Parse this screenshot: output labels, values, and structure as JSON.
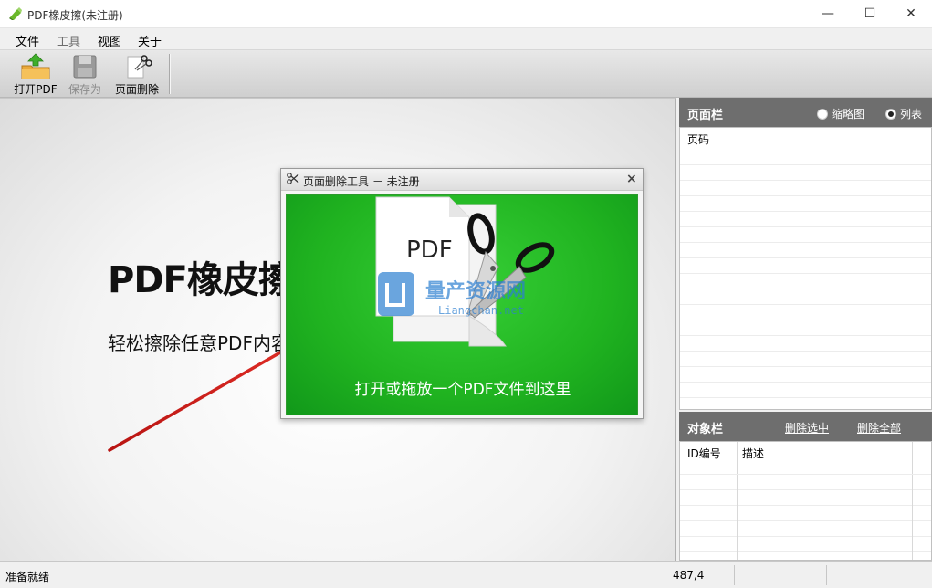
{
  "window": {
    "title": "PDF橡皮擦(未注册)",
    "minimize": "—",
    "maximize": "☐",
    "close": "✕"
  },
  "menu": [
    {
      "label": "文件",
      "enabled": true
    },
    {
      "label": "工具",
      "enabled": false
    },
    {
      "label": "视图",
      "enabled": true
    },
    {
      "label": "关于",
      "enabled": true
    }
  ],
  "toolbar": {
    "open_pdf": "打开PDF",
    "save_as": "保存为",
    "page_delete": "页面删除"
  },
  "main": {
    "brand_title": "PDF橡皮擦",
    "brand_subtitle": "轻松擦除任意PDF内容"
  },
  "dialog": {
    "title": "页面删除工具 － 未注册",
    "close": "×",
    "drop_text": "打开或拖放一个PDF文件到这里",
    "doc_label": "PDF"
  },
  "watermark": {
    "name": "量产资源网",
    "url": "Liangchan.net"
  },
  "page_panel": {
    "title": "页面栏",
    "view_thumbnail": "缩略图",
    "view_list": "列表",
    "selected_view": "list",
    "column_page": "页码"
  },
  "object_panel": {
    "title": "对象栏",
    "delete_selected": "删除选中",
    "delete_all": "删除全部",
    "column_id": "ID编号",
    "column_desc": "描述"
  },
  "status": {
    "message": "准备就绪",
    "coords": "487,4"
  },
  "colors": {
    "accent_green": "#20b320",
    "panel_header": "#6e6e6e",
    "arrow_red": "#d8201c"
  }
}
